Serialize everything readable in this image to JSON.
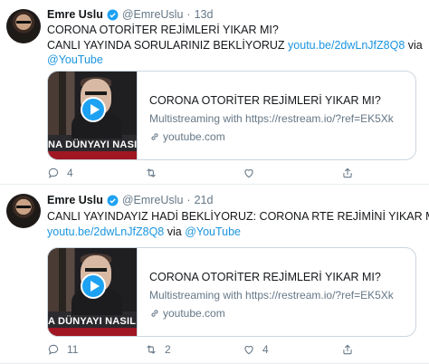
{
  "tweets": [
    {
      "name": "Emre Uslu",
      "handle": "@EmreUslu",
      "time": "13d",
      "line1": "CORONA OTORİTER REJİMLERİ YIKAR MI?",
      "line2_text": "CANLI YAYINDA SORULARINIZ BEKLİYORUZ ",
      "line2_link": "youtu.be/2dwLnJfZ8Q8",
      "line2_via": " via",
      "line3_link": "@YouTube",
      "card": {
        "title": "CORONA OTORİTER REJİMLERİ YIKAR MI?",
        "description": "Multistreaming with https://restream.io/?ref=EK5Xk",
        "domain": "youtube.com",
        "thumb_banner": "NA DÜNYAYI NASIL ETKİL"
      },
      "replies": "4",
      "retweets": "",
      "likes": ""
    },
    {
      "name": "Emre Uslu",
      "handle": "@EmreUslu",
      "time": "21d",
      "line1": "CANLI YAYINDAYIZ HADİ BEKLİYORUZ: CORONA RTE REJİMİNİ YIKAR MI?",
      "line2_link": "youtu.be/2dwLnJfZ8Q8",
      "line2_via": " via ",
      "line2_link2": "@YouTube",
      "card": {
        "title": "CORONA OTORİTER REJİMLERİ YIKAR MI?",
        "description": "Multistreaming with https://restream.io/?ref=EK5Xk",
        "domain": "youtube.com",
        "thumb_banner": "A DÜNYAYI NASIL ETKİL"
      },
      "replies": "11",
      "retweets": "2",
      "likes": "4"
    }
  ],
  "colors": {
    "link": "#1b95e0",
    "muted": "#657786",
    "verified": "#1da1f2",
    "banner_red": "#a01622"
  },
  "icons": [
    "verified-badge-icon",
    "reply-icon",
    "retweet-icon",
    "like-icon",
    "share-icon",
    "play-icon",
    "link-icon"
  ]
}
